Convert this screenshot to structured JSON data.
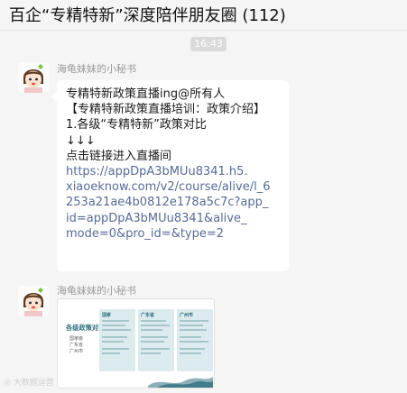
{
  "window": {
    "title": "百企“专精特新”深度陪伴朋友圈 (112)"
  },
  "time_divider": "16:43",
  "messages": [
    {
      "sender": "海龟妹妹的小秘书",
      "avatar_icon": "cartoon-girl-avatar",
      "text_lines": [
        "专精特新政策直播ing@所有人",
        "【专精特新政策直播培训：政策介绍】",
        "1.各级“专精特新”政策对比",
        "↓↓↓",
        "点击链接进入直播间"
      ],
      "link_lines": [
        "https://appDpA3bMUu8341.h5.",
        "xiaoeknow.com/v2/course/alive/l_6",
        "253a21ae4b0812e178a5c7c?app_",
        "id=appDpA3bMUu8341&alive_",
        "mode=0&pro_id=&type=2"
      ]
    },
    {
      "sender": "海龟妹妹的小秘书",
      "avatar_icon": "cartoon-girl-avatar",
      "image": {
        "title": "各级政策对比",
        "labels": [
          "国家级",
          "广东省",
          "广州市"
        ],
        "columns": [
          "国家",
          "广东省",
          "广州市"
        ]
      }
    }
  ],
  "watermark": "大数据运营",
  "colors": {
    "link": "#576b95",
    "background": "#f5f5f5",
    "bubble": "#ffffff",
    "time_pill": "#dadada",
    "image_accent": "#2f6e7d"
  }
}
